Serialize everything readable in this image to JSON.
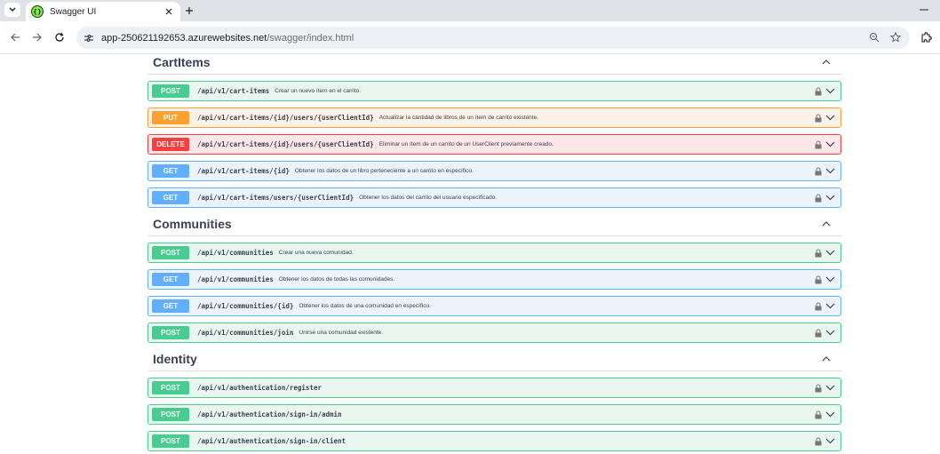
{
  "browser": {
    "tab_title": "Swagger UI",
    "url_host": "app-250621192653.azurewebsites.net",
    "url_path": "/swagger/index.html"
  },
  "icons": {
    "tab_menu": "chevron-down-icon",
    "favicon": "swagger-logo-icon",
    "tab_close": "close-icon",
    "new_tab": "plus-icon",
    "minimize": "minimize-icon",
    "back": "back-arrow-icon",
    "forward": "forward-arrow-icon",
    "reload": "reload-icon",
    "site_info": "tune-icon",
    "zoom": "zoom-out-icon",
    "bookmark": "star-icon",
    "extensions": "puzzle-icon",
    "lock": "lock-icon",
    "expand": "chevron-down-icon",
    "collapse": "chevron-up-icon"
  },
  "colors": {
    "post": "#49cc90",
    "put": "#fca130",
    "delete": "#f93e3e",
    "get": "#61affe",
    "text": "#3b4151"
  },
  "tags": [
    {
      "name": "CartItems",
      "operations": [
        {
          "method": "POST",
          "path": "/api/v1/cart-items",
          "summary": "Crear un nuevo ítem en el carrito."
        },
        {
          "method": "PUT",
          "path": "/api/v1/cart-items/{id}/users/{userClientId}",
          "summary": "Actualizar la cantidad de libros de un ítem de carrito existente."
        },
        {
          "method": "DELETE",
          "path": "/api/v1/cart-items/{id}/users/{userClientId}",
          "summary": "Eliminar un ítem de un carrito de un UserClient previamente creado."
        },
        {
          "method": "GET",
          "path": "/api/v1/cart-items/{id}",
          "summary": "Obtener los datos de un libro perteneciente a un carrito en específico."
        },
        {
          "method": "GET",
          "path": "/api/v1/cart-items/users/{userClientId}",
          "summary": "Obtener los datos del carrito del usuario especificado."
        }
      ]
    },
    {
      "name": "Communities",
      "operations": [
        {
          "method": "POST",
          "path": "/api/v1/communities",
          "summary": "Crear una nueva comunidad."
        },
        {
          "method": "GET",
          "path": "/api/v1/communities",
          "summary": "Obtener los datos de todas las comunidades."
        },
        {
          "method": "GET",
          "path": "/api/v1/communities/{id}",
          "summary": "Obtener los datos de una comunidad en específico."
        },
        {
          "method": "POST",
          "path": "/api/v1/communities/join",
          "summary": "Unirse una comunidad existente."
        }
      ]
    },
    {
      "name": "Identity",
      "operations": [
        {
          "method": "POST",
          "path": "/api/v1/authentication/register",
          "summary": ""
        },
        {
          "method": "POST",
          "path": "/api/v1/authentication/sign-in/admin",
          "summary": ""
        },
        {
          "method": "POST",
          "path": "/api/v1/authentication/sign-in/client",
          "summary": ""
        }
      ]
    }
  ]
}
